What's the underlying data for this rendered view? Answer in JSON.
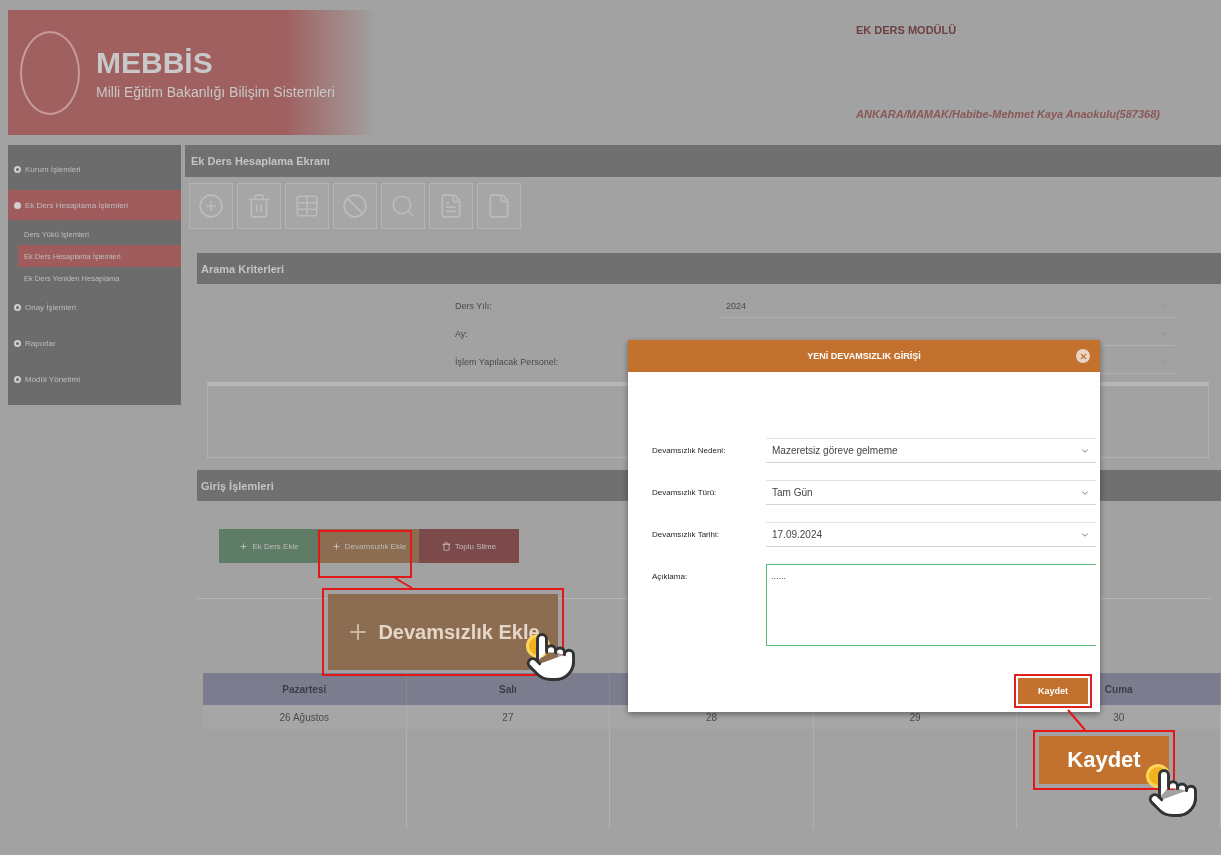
{
  "header": {
    "app_name": "MEBBİS",
    "app_subtitle": "Milli Eğitim Bakanlığı Bilişim Sistemleri",
    "module_title": "EK DERS MODÜLÜ",
    "institution": "ANKARA/MAMAK/Habibe-Mehmet Kaya Anaokulu(587368)"
  },
  "sidebar": {
    "items": [
      {
        "label": "Kurum İşlemleri",
        "selected": false,
        "expanded": false
      },
      {
        "label": "Ek Ders Hesaplama İşlemleri",
        "selected": true,
        "expanded": true,
        "children": [
          {
            "label": "Ders Yükü İşlemleri",
            "selected": false
          },
          {
            "label": "Ek Ders Hesaplama İşlemleri",
            "selected": true
          },
          {
            "label": "Ek Ders Yeniden Hesaplama",
            "selected": false
          }
        ]
      },
      {
        "label": "Onay İşlemleri",
        "selected": false,
        "expanded": false
      },
      {
        "label": "Raporlar",
        "selected": false,
        "expanded": false
      },
      {
        "label": "Modül Yönetimi",
        "selected": false,
        "expanded": false
      }
    ]
  },
  "panel_title": "Ek Ders Hesaplama Ekranı",
  "toolbar": [
    {
      "kind": "add"
    },
    {
      "kind": "delete"
    },
    {
      "kind": "save"
    },
    {
      "kind": "cancel"
    },
    {
      "kind": "search"
    },
    {
      "kind": "report"
    },
    {
      "kind": "exit"
    }
  ],
  "search_criteria": {
    "title": "Arama Kriterleri",
    "fields": [
      {
        "label": "Ders Yılı:",
        "value": "2024"
      },
      {
        "label": "Ay:"
      },
      {
        "label": "İşlem Yapılacak Personel:"
      }
    ]
  },
  "entry_section": {
    "title": "Giriş İşlemleri",
    "buttons": [
      {
        "label": "Ek Ders Ekle",
        "kind": "add",
        "color": "#5f7c66"
      },
      {
        "label": "Devamsızlık Ekle",
        "kind": "add",
        "color": "#8c6d52"
      },
      {
        "label": "Toplu Silme",
        "kind": "delete",
        "color": "#7c4a4a"
      }
    ]
  },
  "calendar": {
    "columns": [
      {
        "day": "Pazartesi",
        "date": "26 Ağustos"
      },
      {
        "day": "Salı",
        "date": "27"
      },
      {
        "date": "28"
      },
      {
        "date": "29"
      },
      {
        "day": "Cuma",
        "date": "30"
      }
    ]
  },
  "dialog": {
    "title": "YENİ DEVAMSIZLIK GİRİŞİ",
    "fields": [
      {
        "kind": "select",
        "label": "Devamsızlık Nedeni:",
        "value": "Mazeretsiz göreve gelmeme"
      },
      {
        "kind": "select",
        "label": "Devamsızlık Türü:",
        "value": "Tam Gün"
      },
      {
        "kind": "select",
        "label": "Devamsızlık Tarihi:",
        "value": "17.09.2024"
      },
      {
        "kind": "textarea",
        "label": "Açıklama:",
        "value": "......"
      }
    ],
    "save_button": "Kaydet"
  },
  "callouts": [
    {
      "kind": "add",
      "label": "Devamsızlık Ekle"
    },
    {
      "kind": "save",
      "label": "Kaydet"
    }
  ]
}
